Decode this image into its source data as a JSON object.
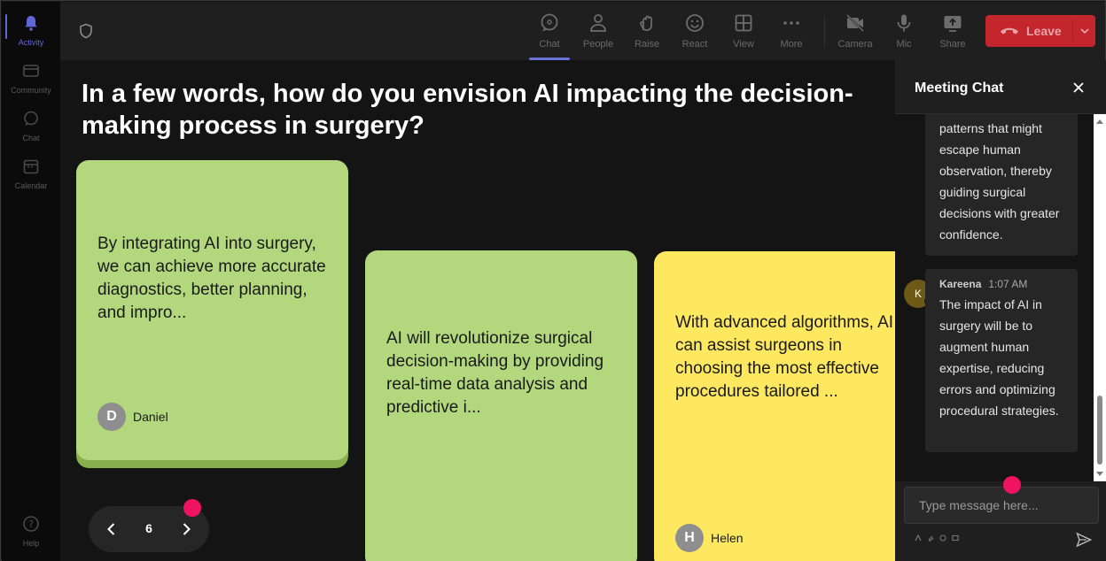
{
  "rail": {
    "items": [
      {
        "label": "Activity",
        "icon": "bell-icon",
        "active": true
      },
      {
        "label": "Community",
        "icon": "community-icon"
      },
      {
        "label": "Chat",
        "icon": "chat-icon"
      },
      {
        "label": "Calendar",
        "icon": "calendar-icon"
      }
    ],
    "help_label": "Help",
    "accent_color": "#5f68d8"
  },
  "toolbar": {
    "buttons": [
      {
        "label": "Chat",
        "icon": "chat-icon",
        "active": true
      },
      {
        "label": "People",
        "icon": "people-icon"
      },
      {
        "label": "Raise",
        "icon": "raise-hand-icon"
      },
      {
        "label": "React",
        "icon": "smiley-icon"
      },
      {
        "label": "View",
        "icon": "grid-view-icon"
      },
      {
        "label": "More",
        "icon": "more-dots-icon"
      },
      {
        "label": "Camera",
        "icon": "camera-off-icon"
      },
      {
        "label": "Mic",
        "icon": "mic-icon"
      },
      {
        "label": "Share",
        "icon": "share-icon"
      }
    ],
    "leave_label": "Leave",
    "leave_color": "#c4262e"
  },
  "stage": {
    "question": "In a few words, how do you envision AI impacting the decision-making process in surgery?",
    "notes": [
      {
        "text": "By integrating AI into surgery, we can achieve more accurate diagnostics, better planning, and impro...",
        "author": "Daniel",
        "initial": "D",
        "color": "#b2d77c"
      },
      {
        "text": "AI will revolutionize surgical decision-making by providing real-time data analysis and predictive i...",
        "author": "",
        "initial": "",
        "color": "#b2d77c"
      },
      {
        "text": "With advanced algorithms, AI can assist surgeons in choosing the most effective procedures tailored ...",
        "author": "Helen",
        "initial": "H",
        "color": "#fde860"
      }
    ],
    "page_number": "6"
  },
  "chat": {
    "title": "Meeting Chat",
    "messages": [
      {
        "text": "patterns that might escape human observation, thereby guiding surgical decisions with greater confidence."
      },
      {
        "sender": "Kareena",
        "initial": "K",
        "time": "1:07 AM",
        "text": "The impact of AI in surgery will be to augment human expertise, reducing errors and optimizing procedural strategies."
      }
    ],
    "input_placeholder": "Type message here..."
  }
}
